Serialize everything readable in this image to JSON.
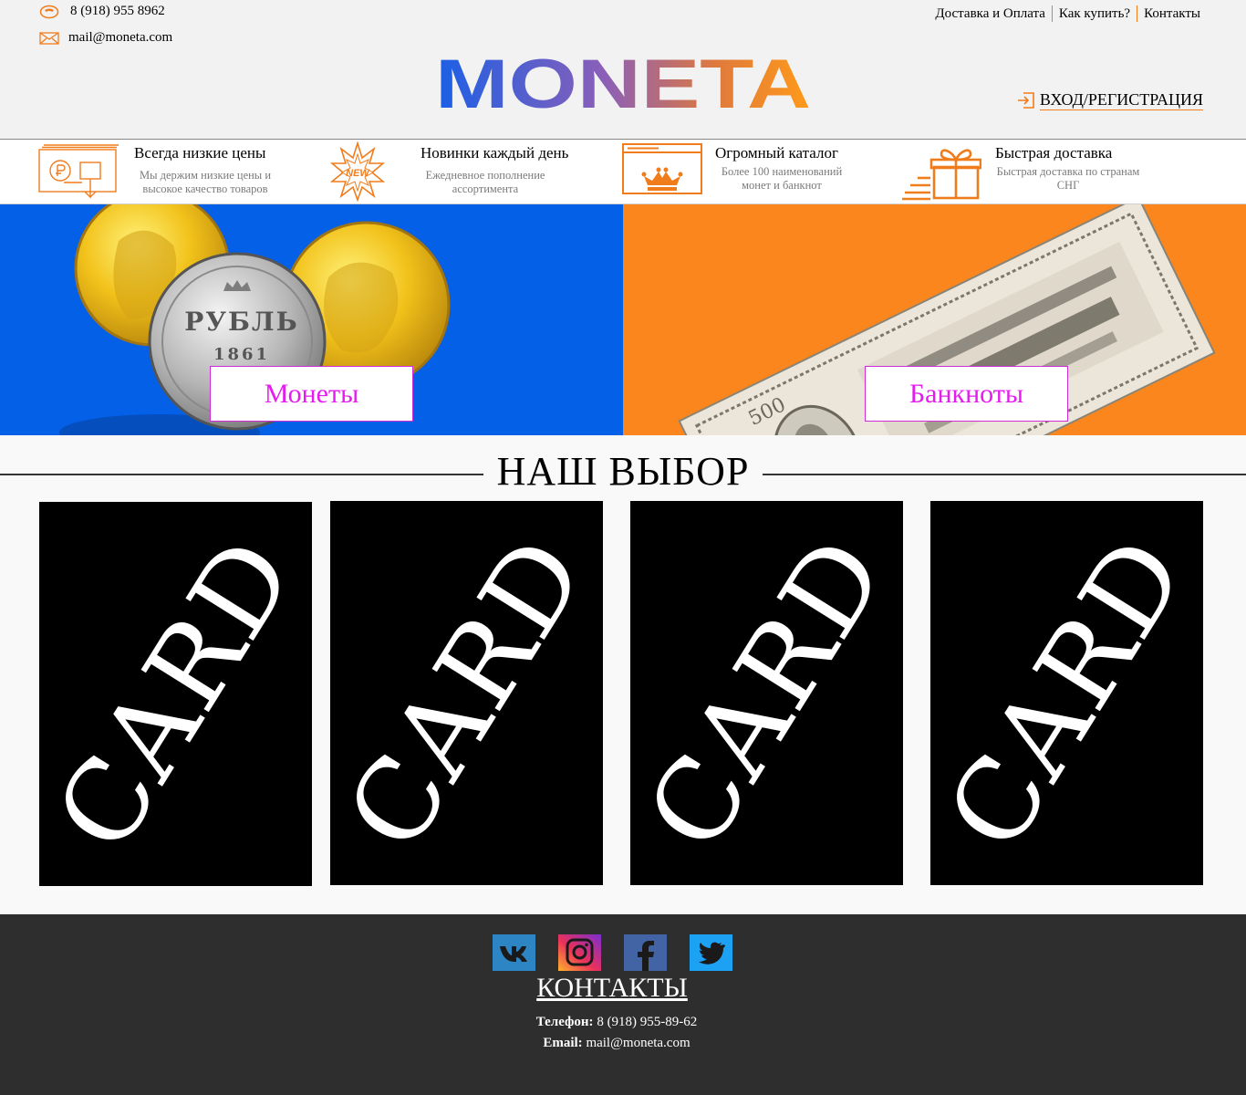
{
  "header": {
    "phone": "8 (918) 955 8962",
    "email": "mail@moneta.com",
    "nav": [
      "Доставка и Оплата",
      "Как купить?",
      "Контакты"
    ],
    "logo": "MONETA",
    "login": "ВХОД/РЕГИСТРАЦИЯ"
  },
  "features": [
    {
      "icon": "price-tag-icon",
      "title": "Всегда низкие цены",
      "text": "Мы держим низкие цены и высокое качество товаров"
    },
    {
      "icon": "new-badge-icon",
      "title": "Новинки каждый день",
      "text": "Ежедневное пополнение ассортимента"
    },
    {
      "icon": "catalog-crown-icon",
      "title": "Огромный каталог",
      "text": "Более 100 наименований монет и банкнот"
    },
    {
      "icon": "gift-delivery-icon",
      "title": "Быстрая доставка",
      "text": "Быстрая доставка по странам СНГ"
    }
  ],
  "badge_new": "NEW",
  "banners": {
    "coins": {
      "label": "Монеты",
      "coin_text": "РУБЛЬ",
      "coin_year": "1861"
    },
    "notes": {
      "label": "Банкноты",
      "note_value": "500"
    }
  },
  "section_title": "НАШ ВЫБОР",
  "cards": [
    "CARD",
    "CARD",
    "CARD",
    "CARD"
  ],
  "footer": {
    "socials": [
      "vk-icon",
      "instagram-icon",
      "facebook-icon",
      "twitter-icon"
    ],
    "title": "КОНТАКТЫ",
    "phone_label": "Телефон:",
    "phone": "8 (918) 955-89-62",
    "email_label": "Email:",
    "email": "mail@moneta.com"
  },
  "colors": {
    "accent": "#f07c1c",
    "coins_bg": "#0560e8",
    "notes_bg": "#fb861e",
    "button_text": "#e51cef",
    "footer_bg": "#2e2e2e"
  }
}
